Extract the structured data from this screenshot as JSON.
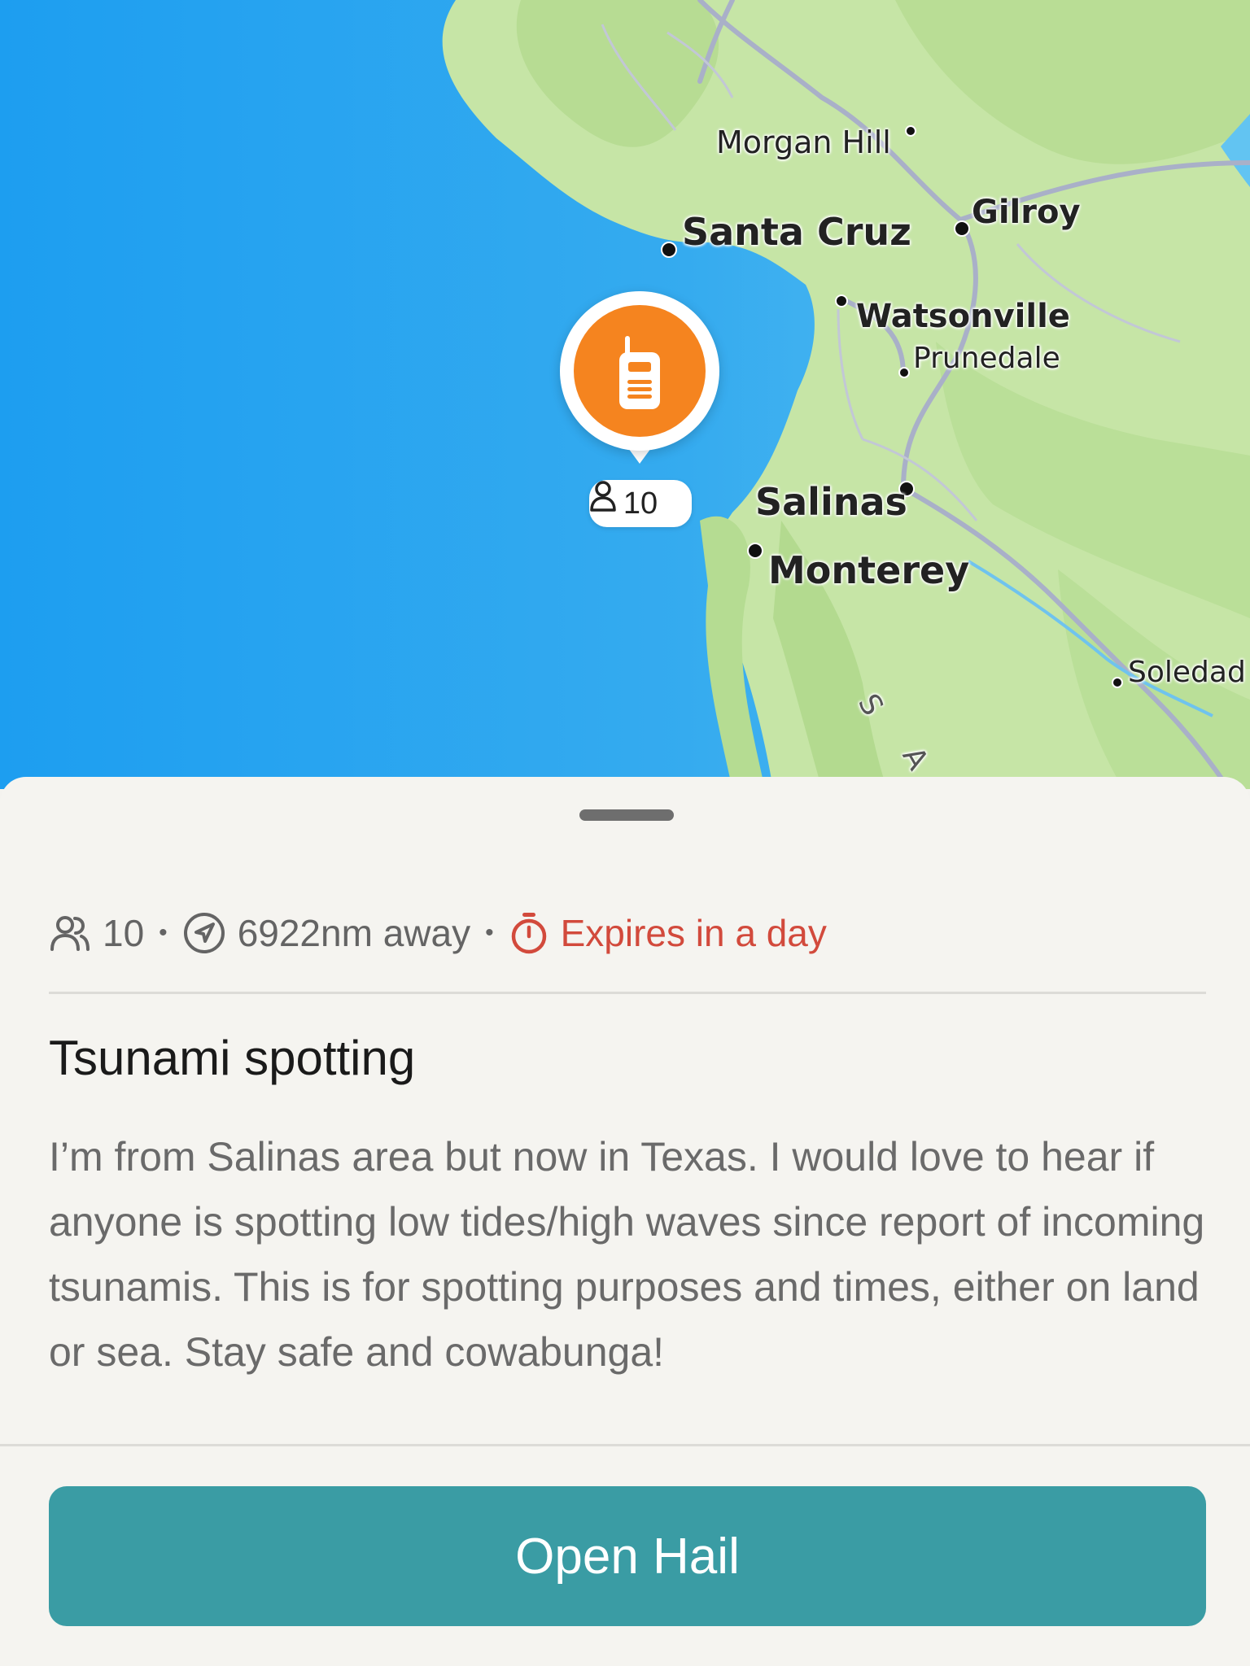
{
  "map": {
    "cities": [
      {
        "id": "morgan-hill",
        "name": "Morgan Hill"
      },
      {
        "id": "santa-cruz",
        "name": "Santa Cruz"
      },
      {
        "id": "gilroy",
        "name": "Gilroy"
      },
      {
        "id": "watsonville",
        "name": "Watsonville"
      },
      {
        "id": "prunedale",
        "name": "Prunedale"
      },
      {
        "id": "salinas",
        "name": "Salinas"
      },
      {
        "id": "monterey",
        "name": "Monterey"
      },
      {
        "id": "soledad",
        "name": "Soledad"
      }
    ],
    "range_label": [
      "S",
      "A"
    ],
    "pin": {
      "icon": "radio-icon",
      "color": "#f5841f",
      "count": "10",
      "count_icon": "person-icon"
    }
  },
  "hail": {
    "members": "10",
    "distance": "6922nm away",
    "expires": "Expires in a day",
    "title": "Tsunami spotting",
    "description": "I’m from Salinas area but now in Texas. I would love to hear if anyone is spotting low tides/high waves since report of incoming tsunamis. This is for spotting purposes and times, either on land or sea. Stay safe and cowabunga!",
    "button_label": "Open Hail"
  },
  "colors": {
    "accent": "#3a9ca4",
    "expires": "#d24a3c",
    "pin": "#f5841f",
    "water": "#2fa7ee",
    "land": "#c9e6a8"
  }
}
